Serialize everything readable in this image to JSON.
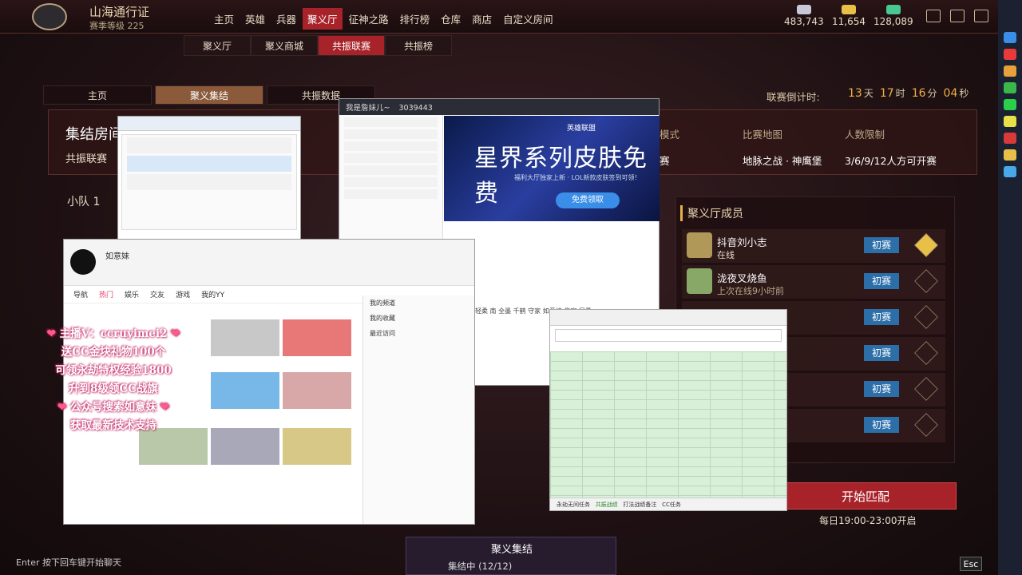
{
  "topbar": {
    "brand": "山海通行证",
    "season": "赛季等级 225",
    "nav": [
      "主页",
      "英雄",
      "兵器",
      "聚义厅",
      "征神之路",
      "排行榜",
      "仓库",
      "商店",
      "自定义房间"
    ],
    "active_nav": "聚义厅",
    "currencies": [
      {
        "value": "483,743",
        "color": "#c8c8d8"
      },
      {
        "value": "11,654",
        "color": "#e8c048"
      },
      {
        "value": "128,089",
        "color": "#48c890"
      }
    ]
  },
  "subnav": [
    "聚义厅",
    "聚义商城",
    "共振联赛",
    "共振榜"
  ],
  "subnav_active": "共振联赛",
  "tabs": [
    "主页",
    "聚义集结",
    "共振数据"
  ],
  "tabs_active": "聚义集结",
  "countdown": {
    "label": "联赛倒计时:",
    "days": "13",
    "days_unit": "天",
    "hours": "17",
    "hours_unit": "时",
    "minutes": "16",
    "minutes_unit": "分",
    "seconds": "04",
    "seconds_unit": "秒"
  },
  "info": {
    "title": "集结房间",
    "subtitle": "共振联赛",
    "mode_label": "模式",
    "mode_value": "赛",
    "map_label": "比赛地图",
    "map_value": "地脉之战 · 神鹰堡",
    "limit_label": "人数限制",
    "limit_value": "3/6/9/12人方可开赛"
  },
  "squad": {
    "label": "小队 1"
  },
  "members": {
    "title": "聚义厅成员",
    "rows": [
      {
        "name": "抖音刘小志",
        "status": "在线",
        "badge": "初赛"
      },
      {
        "name": "泷夜叉烧鱼",
        "status": "上次在线9小时前",
        "badge": "初赛"
      },
      {
        "name": "",
        "status": "",
        "badge": "初赛"
      },
      {
        "name": "",
        "status": "",
        "badge": "初赛"
      },
      {
        "name": "",
        "status": "",
        "badge": "初赛"
      },
      {
        "name": "",
        "status": "",
        "badge": "初赛"
      }
    ]
  },
  "start": {
    "label": "开始匹配",
    "schedule": "每日19:00-23:00开启"
  },
  "gather": {
    "title": "聚义集结",
    "status": "集结中 (12/12)"
  },
  "esc": "Esc",
  "enter_hint": "Enter 按下回车键开始聊天",
  "promo": {
    "line1": "主播V：ccruyimei2",
    "line2": "送CC金块礼物100个",
    "line3": "可领永劫特权经验1800",
    "line4": "升到8级领CC战旗",
    "line5": "公众号搜索如意妹",
    "line6": "获取最新技术支持"
  },
  "overlay": {
    "qq_title": "我是詹妹儿~",
    "qq_count": "3039443",
    "banner_logo": "英雄联盟",
    "banner_big": "星界系列皮肤免费",
    "banner_small": "福利大厅独家上新 · LOL新款皮肤签到可领！",
    "banner_btn": "免费领取",
    "cc_name": "如意妹",
    "cc_tabs": [
      "导航",
      "热门",
      "娱乐",
      "交友",
      "游戏",
      "我的YY"
    ],
    "sheet_tabs": [
      "永劫无间任务",
      "共振战绩",
      "打法战绩备注",
      "CC任务"
    ],
    "chat_members": "轻柔  南  全墨  千鹤  守家  如意妹  俊家  居寻",
    "right_list": [
      "我的频道",
      "我的收藏",
      "最近访问"
    ]
  },
  "colors": {
    "accent": "#a8222a",
    "gold": "#f0b048",
    "badge": "#2c6ea8"
  }
}
